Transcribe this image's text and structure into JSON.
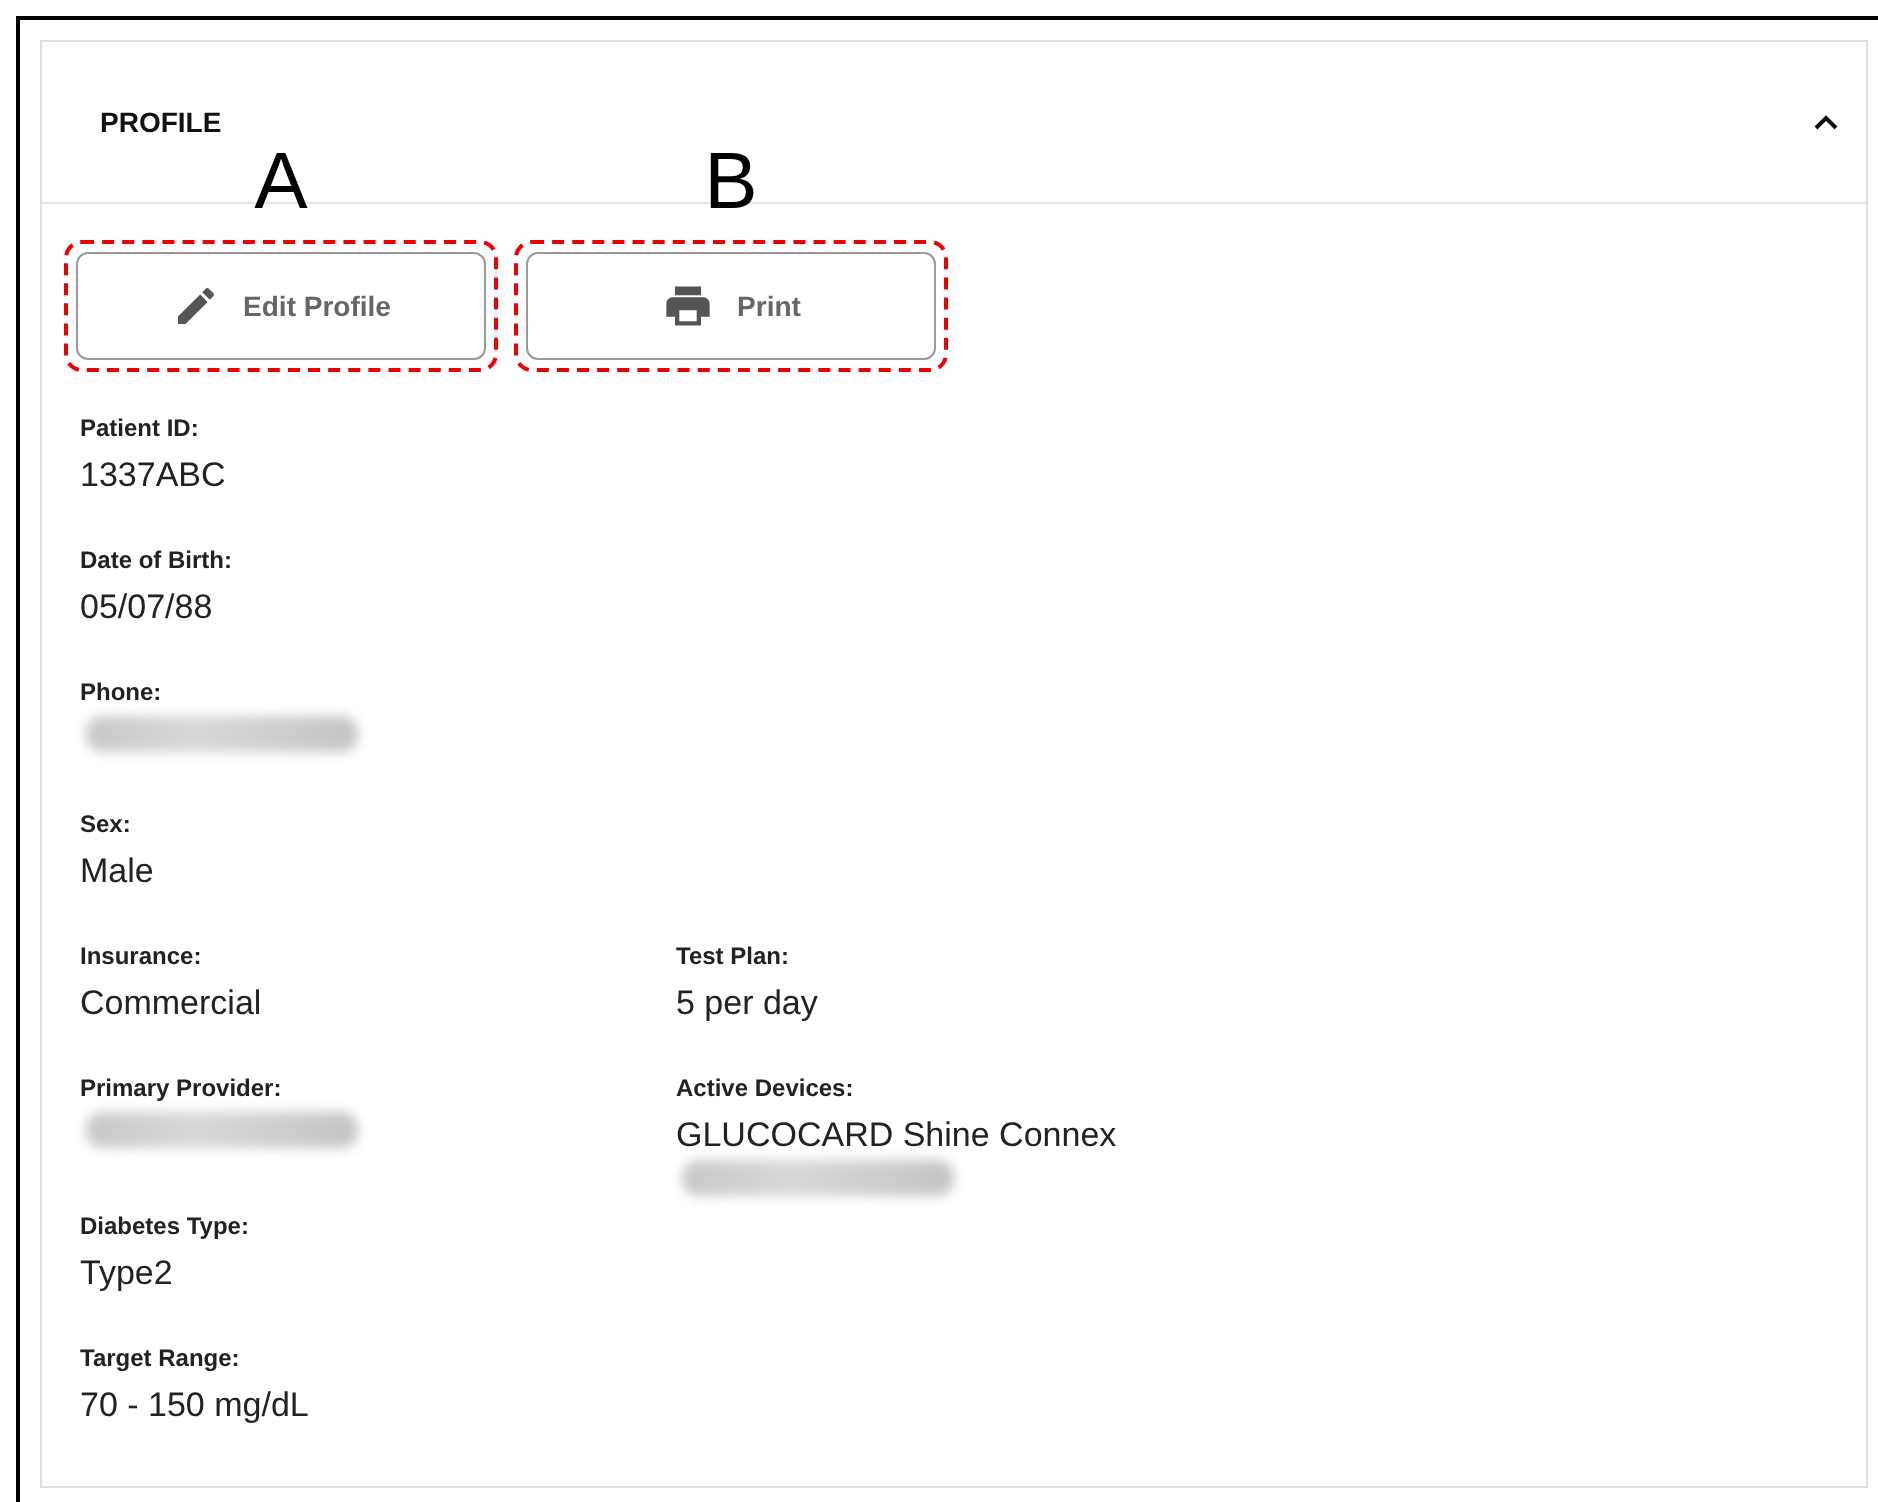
{
  "section": {
    "title": "PROFILE",
    "expanded": true
  },
  "buttons": [
    {
      "label": "Edit Profile",
      "kind": "pencil",
      "marker": "A"
    },
    {
      "label": "Print",
      "kind": "printer",
      "marker": "B"
    }
  ],
  "rows": [
    {
      "cells": [
        {
          "label": "Patient ID:",
          "value": "1337ABC"
        }
      ]
    },
    {
      "cells": [
        {
          "label": "Date of Birth:",
          "value": "05/07/88"
        }
      ]
    },
    {
      "cells": [
        {
          "label": "Phone:",
          "redacted": true
        }
      ]
    },
    {
      "cells": [
        {
          "label": "Sex:",
          "value": "Male"
        }
      ]
    },
    {
      "cells": [
        {
          "label": "Insurance:",
          "value": "Commercial"
        },
        {
          "label": "Test Plan:",
          "value": "5 per day"
        }
      ]
    },
    {
      "cells": [
        {
          "label": "Primary Provider:",
          "redacted": true
        },
        {
          "label": "Active Devices:",
          "value": "GLUCOCARD Shine Connex",
          "redacted": true
        }
      ]
    },
    {
      "cells": [
        {
          "label": "Diabetes Type:",
          "value": "Type2"
        }
      ]
    },
    {
      "cells": [
        {
          "label": "Target Range:",
          "value": "70 - 150 mg/dL"
        }
      ]
    }
  ]
}
